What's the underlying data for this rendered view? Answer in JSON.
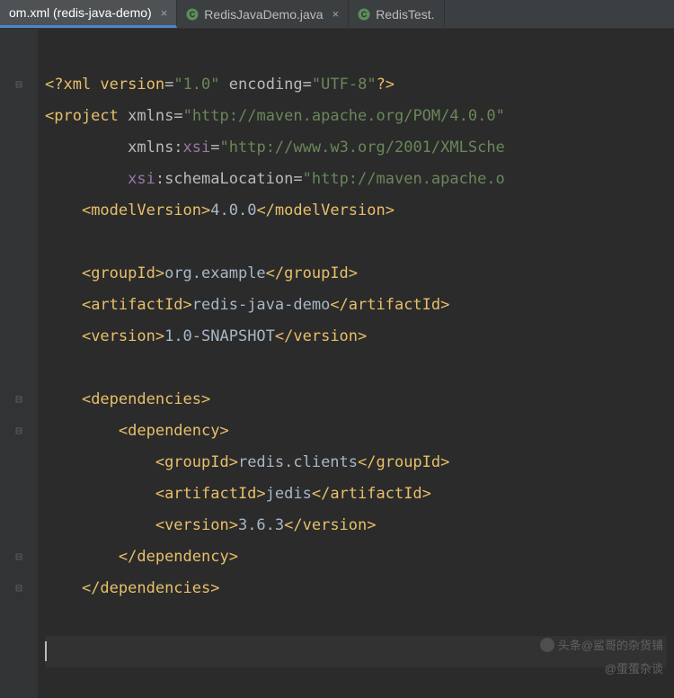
{
  "tabs": {
    "t0": {
      "label": "om.xml (redis-java-demo)"
    },
    "t1": {
      "label": "RedisJavaDemo.java"
    },
    "t2": {
      "label": "RedisTest."
    }
  },
  "code": {
    "xml_decl_open": "<?",
    "xml_decl_name": "xml version",
    "xml_decl_ver": "\"1.0\"",
    "xml_decl_enc_attr": "encoding",
    "xml_decl_enc_val": "\"UTF-8\"",
    "xml_decl_close": "?>",
    "project_open": "<project",
    "xmlns_attr": "xmlns",
    "xmlns_val": "\"http://maven.apache.org/POM/4.0.0\"",
    "xmlns_xsi_prefix": "xmlns:",
    "xsi": "xsi",
    "xmlns_xsi_val": "\"http://www.w3.org/2001/XMLSche",
    "schemaloc_attr": ":schemaLocation",
    "schemaloc_val": "\"http://maven.apache.o",
    "modelVersion_open": "<modelVersion>",
    "modelVersion_text": "4.0.0",
    "modelVersion_close": "</modelVersion>",
    "groupId_open": "<groupId>",
    "groupId_text": "org.example",
    "groupId_close": "</groupId>",
    "artifactId_open": "<artifactId>",
    "artifactId_text": "redis-java-demo",
    "artifactId_close": "</artifactId>",
    "version_open": "<version>",
    "version_text": "1.0-SNAPSHOT",
    "version_close": "</version>",
    "deps_open": "<dependencies>",
    "dep_open": "<dependency>",
    "dep_groupId_text": "redis.clients",
    "dep_artifactId_text": "jedis",
    "dep_version_text": "3.6.3",
    "dep_close": "</dependency>",
    "deps_close": "</dependencies>"
  },
  "watermarks": {
    "w1": "头条@鲨哥的杂货铺",
    "w2": "@蛋蛋杂谈"
  }
}
